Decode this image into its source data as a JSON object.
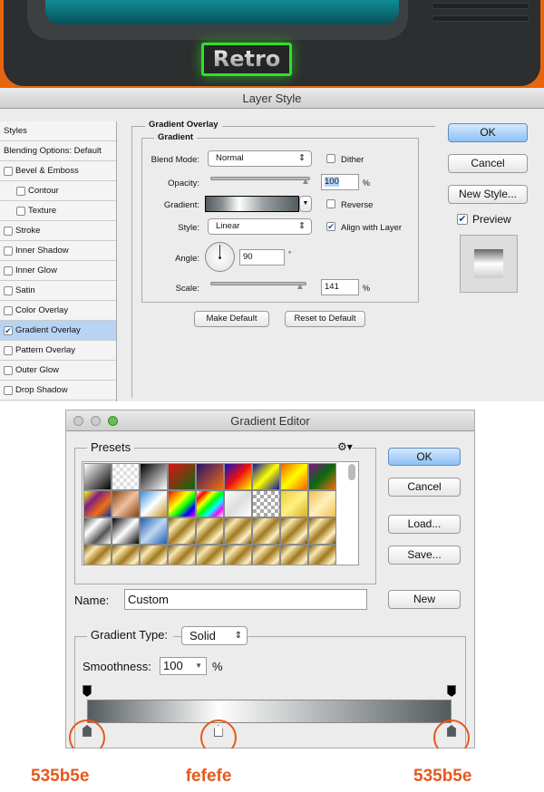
{
  "artwork": {
    "label_text": "Retro"
  },
  "layer_style": {
    "title": "Layer Style",
    "sidebar": [
      {
        "label": "Styles",
        "checkbox": false
      },
      {
        "label": "Blending Options: Default",
        "checkbox": false
      },
      {
        "label": "Bevel & Emboss",
        "checkbox": true,
        "checked": false
      },
      {
        "label": "Contour",
        "checkbox": true,
        "checked": false,
        "indent": true
      },
      {
        "label": "Texture",
        "checkbox": true,
        "checked": false,
        "indent": true
      },
      {
        "label": "Stroke",
        "checkbox": true,
        "checked": false
      },
      {
        "label": "Inner Shadow",
        "checkbox": true,
        "checked": false
      },
      {
        "label": "Inner Glow",
        "checkbox": true,
        "checked": false
      },
      {
        "label": "Satin",
        "checkbox": true,
        "checked": false
      },
      {
        "label": "Color Overlay",
        "checkbox": true,
        "checked": false
      },
      {
        "label": "Gradient Overlay",
        "checkbox": true,
        "checked": true,
        "selected": true
      },
      {
        "label": "Pattern Overlay",
        "checkbox": true,
        "checked": false
      },
      {
        "label": "Outer Glow",
        "checkbox": true,
        "checked": false
      },
      {
        "label": "Drop Shadow",
        "checkbox": true,
        "checked": false
      }
    ],
    "section_title": "Gradient Overlay",
    "group_title": "Gradient",
    "blend_mode_label": "Blend Mode:",
    "blend_mode": "Normal",
    "dither_label": "Dither",
    "dither": false,
    "opacity_label": "Opacity:",
    "opacity": "100",
    "opacity_unit": "%",
    "gradient_label": "Gradient:",
    "reverse_label": "Reverse",
    "reverse": false,
    "style_label": "Style:",
    "style": "Linear",
    "align_label": "Align with Layer",
    "align": true,
    "angle_label": "Angle:",
    "angle": "90",
    "angle_unit": "°",
    "scale_label": "Scale:",
    "scale": "141",
    "scale_unit": "%",
    "make_default": "Make Default",
    "reset_default": "Reset to Default",
    "ok": "OK",
    "cancel": "Cancel",
    "new_style": "New Style...",
    "preview_label": "Preview",
    "preview": true
  },
  "gradient_editor": {
    "title": "Gradient Editor",
    "presets_label": "Presets",
    "ok": "OK",
    "cancel": "Cancel",
    "load": "Load...",
    "save": "Save...",
    "name_label": "Name:",
    "name_value": "Custom",
    "new": "New",
    "type_label": "Gradient Type:",
    "type_value": "Solid",
    "smoothness_label": "Smoothness:",
    "smoothness": "100",
    "smoothness_unit": "%",
    "color_stops": [
      {
        "color": "#535b5e",
        "location": 0
      },
      {
        "color": "#fefefe",
        "location": 36
      },
      {
        "color": "#535b5e",
        "location": 100
      }
    ],
    "opacity_stops": [
      {
        "opacity": 100,
        "location": 0
      },
      {
        "opacity": 100,
        "location": 100
      }
    ]
  },
  "annotations": [
    "535b5e",
    "fefefe",
    "535b5e"
  ],
  "colors": {
    "accent_orange": "#e8581c",
    "retro_border": "#2fe02a",
    "stop_dark": "#535b5e",
    "stop_light": "#fefefe"
  }
}
